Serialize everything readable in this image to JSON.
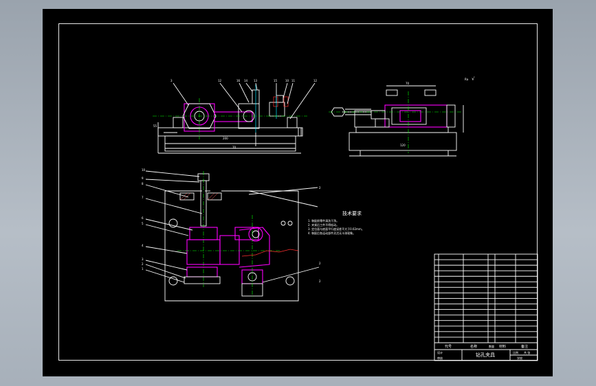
{
  "drawing": {
    "roughness_label": "Ra",
    "roughness_symbol": "√",
    "tech_title": "技术要求",
    "tech_notes": [
      "1. 装配前零件清洗干净。",
      "2. 夹紧后工件不得松动。",
      "3. 定位面与底面平行度误差不大于0.02mm。",
      "4. 装配后各运动部件灵活无卡滞现象。"
    ],
    "balloons_left_top": [
      "3",
      "12",
      "16",
      "14",
      "13",
      "15",
      "10",
      "11",
      "12"
    ],
    "balloons_left_side": [
      "10",
      "9",
      "8",
      "7",
      "6",
      "5",
      "4",
      "3",
      "2",
      "1"
    ],
    "balloons_right_side": [
      "2",
      "2",
      "2"
    ],
    "dims": {
      "front_a": "200",
      "front_b": "70",
      "side_a": "120",
      "side_b": "70",
      "vert_a": "55"
    },
    "title_block": {
      "drawing_name": "钻孔夹具",
      "col_code": "代号",
      "col_name": "名称",
      "col_qty": "数量",
      "col_material": "材料",
      "col_note": "备注",
      "scale": "比例",
      "sheet": "共 张",
      "unit": "学校",
      "sign_a": "设计",
      "sign_b": "审核"
    }
  }
}
